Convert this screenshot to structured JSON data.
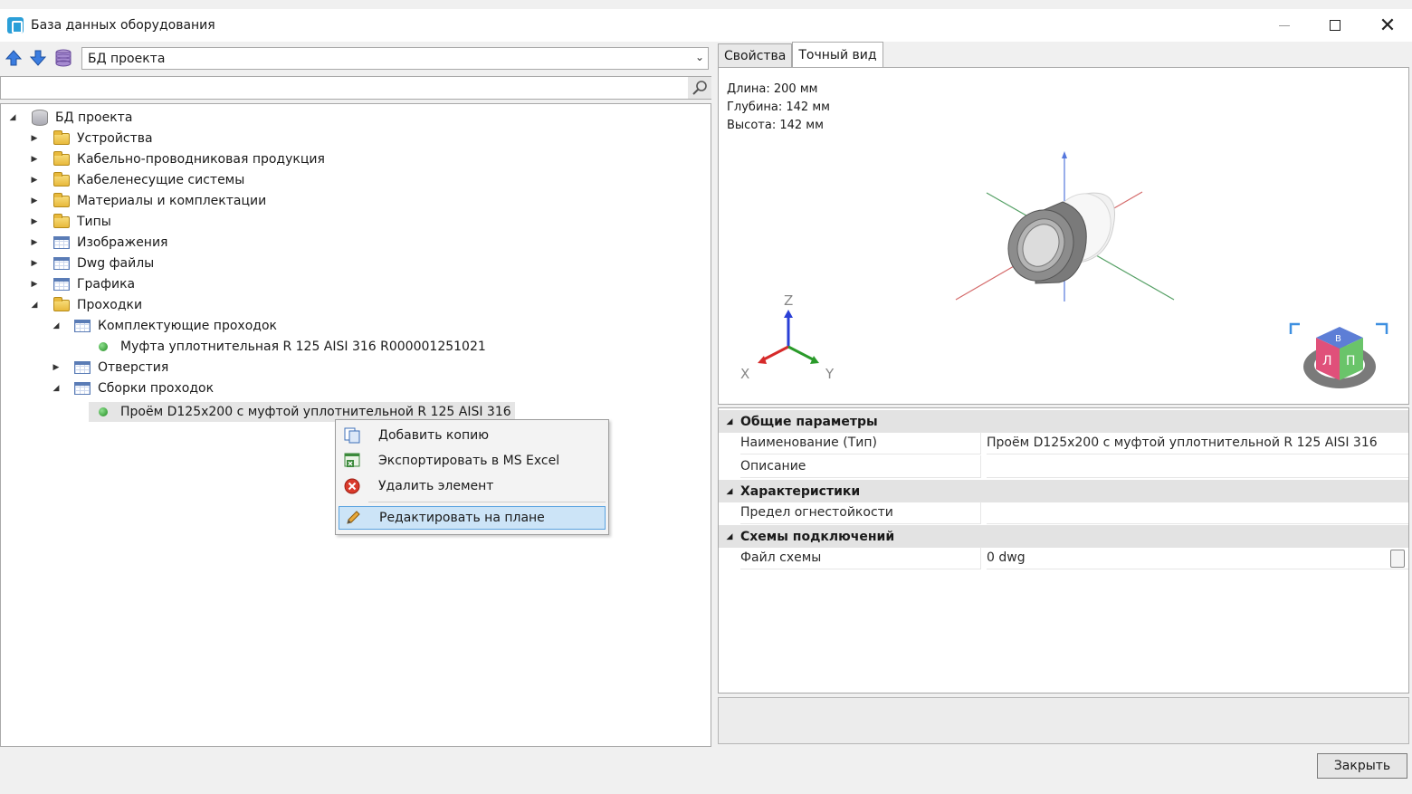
{
  "window": {
    "title": "База данных оборудования",
    "close_glyph": "✕"
  },
  "toolbar": {
    "combo_value": "БД проекта",
    "combo_arrow": "⌄"
  },
  "search": {
    "placeholder": ""
  },
  "tree": {
    "root": "БД проекта",
    "items": [
      "Устройства",
      "Кабельно-проводниковая продукция",
      "Кабеленесущие системы",
      "Материалы и комплектации",
      "Типы",
      "Изображения",
      "Dwg файлы",
      "Графика",
      "Проходки",
      "Комплектующие проходок",
      "Муфта уплотнительная R 125 AISI 316 R000001251021",
      "Отверстия",
      "Сборки проходок",
      "Проём D125x200 с муфтой уплотнительной R 125 AISI 316"
    ],
    "expanded_glyph": "◢",
    "collapsed_glyph": "▶"
  },
  "context_menu": {
    "items": [
      "Добавить копию",
      "Экспортировать в MS Excel",
      "Удалить элемент",
      "Редактировать на плане"
    ]
  },
  "tabs": [
    "Свойства",
    "Точный вид"
  ],
  "view": {
    "length": "Длина: 200 мм",
    "depth": "Глубина: 142 мм",
    "height": "Высота: 142 мм",
    "axis_z": "Z",
    "axis_x": "X",
    "axis_y": "Y",
    "cube_face_top": "В",
    "cube_face_left": "Л",
    "cube_face_right": "П"
  },
  "properties": {
    "cat1": "Общие параметры",
    "name_label": "Наименование (Тип)",
    "name_value": "Проём D125x200 с муфтой уплотнительной R 125 AISI 316",
    "desc_label": "Описание",
    "desc_value": "",
    "cat2": "Характеристики",
    "fire_label": "Предел огнестойкости",
    "fire_value": "",
    "cat3": "Схемы подключений",
    "file_label": "Файл схемы",
    "file_value": "0 dwg"
  },
  "footer": {
    "close_label": "Закрыть"
  },
  "colors": {
    "accent": "#5aa3e0",
    "selection": "#cce4f7"
  }
}
